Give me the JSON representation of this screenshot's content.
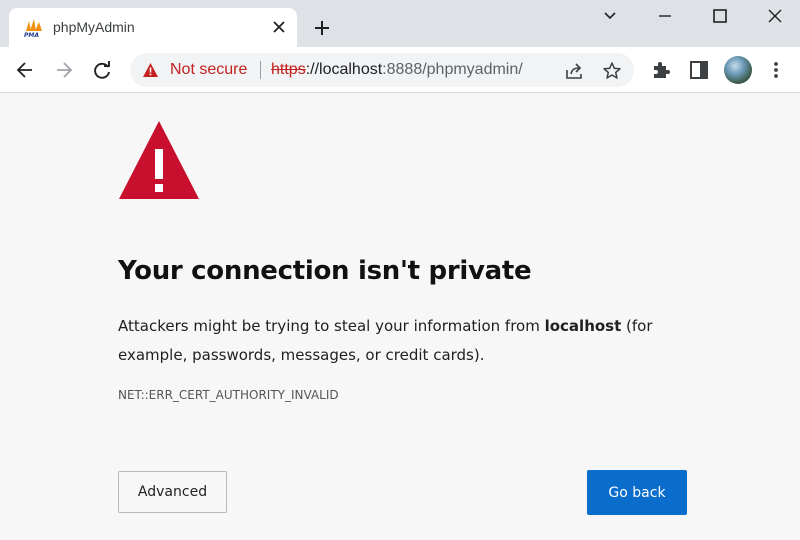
{
  "browser": {
    "tab": {
      "title": "phpMyAdmin",
      "favicon": "phpmyadmin-logo-icon"
    },
    "window_controls": [
      "tab-search-icon",
      "minimize-icon",
      "maximize-icon",
      "close-icon"
    ],
    "omnibox": {
      "security_label": "Not secure",
      "url_scheme": "https",
      "url_rest_host": "://localhost",
      "url_path": ":8888/phpmyadmin/"
    }
  },
  "page": {
    "heading": "Your connection isn't private",
    "description_before": "Attackers might be trying to steal your information from ",
    "description_host": "localhost",
    "description_after": " (for example, passwords, messages, or credit cards).",
    "error_code": "NET::ERR_CERT_AUTHORITY_INVALID",
    "advanced_label": "Advanced",
    "go_back_label": "Go back"
  },
  "colors": {
    "warning_red": "#c8102e",
    "primary_button": "#0a6ccb",
    "not_secure_red": "#c5221f"
  }
}
